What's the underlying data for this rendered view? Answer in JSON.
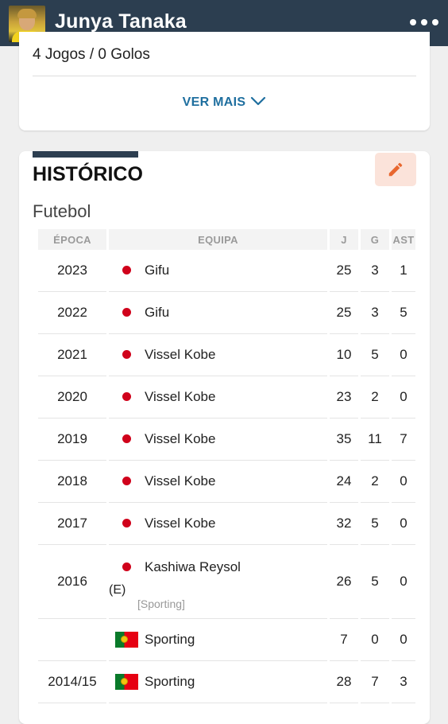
{
  "header": {
    "player_name": "Junya Tanaka",
    "menu_icon": "more-horizontal-icon"
  },
  "summary": {
    "line": "4 Jogos / 0 Golos",
    "ver_mais": "VER MAIS"
  },
  "history": {
    "title": "HISTÓRICO",
    "sport": "Futebol",
    "columns": {
      "season": "ÉPOCA",
      "team": "EQUIPA",
      "games": "J",
      "goals": "G",
      "assists": "AST"
    },
    "rows": [
      {
        "season": "2023",
        "team": "Gifu",
        "flag": "japan",
        "games": "25",
        "goals": "3",
        "assists": "1"
      },
      {
        "season": "2022",
        "team": "Gifu",
        "flag": "japan",
        "games": "25",
        "goals": "3",
        "assists": "5"
      },
      {
        "season": "2021",
        "team": "Vissel Kobe",
        "flag": "japan",
        "games": "10",
        "goals": "5",
        "assists": "0"
      },
      {
        "season": "2020",
        "team": "Vissel Kobe",
        "flag": "japan",
        "games": "23",
        "goals": "2",
        "assists": "0"
      },
      {
        "season": "2019",
        "team": "Vissel Kobe",
        "flag": "japan",
        "games": "35",
        "goals": "11",
        "assists": "7"
      },
      {
        "season": "2018",
        "team": "Vissel Kobe",
        "flag": "japan",
        "games": "24",
        "goals": "2",
        "assists": "0"
      },
      {
        "season": "2017",
        "team": "Vissel Kobe",
        "flag": "japan",
        "games": "32",
        "goals": "5",
        "assists": "0"
      }
    ],
    "loan_row": {
      "season": "2016",
      "team": "Kashiwa Reysol",
      "flag": "japan",
      "tag": "(E)",
      "from": "[Sporting]",
      "games": "26",
      "goals": "5",
      "assists": "0"
    },
    "rows_after": [
      {
        "season": "",
        "team": "Sporting",
        "flag": "portugal",
        "games": "7",
        "goals": "0",
        "assists": "0"
      },
      {
        "season": "2014/15",
        "team": "Sporting",
        "flag": "portugal",
        "games": "28",
        "goals": "7",
        "assists": "3"
      }
    ]
  },
  "colors": {
    "header_bg": "#2c3e50",
    "link": "#1f6f9f",
    "edit_accent": "#e8672f"
  }
}
